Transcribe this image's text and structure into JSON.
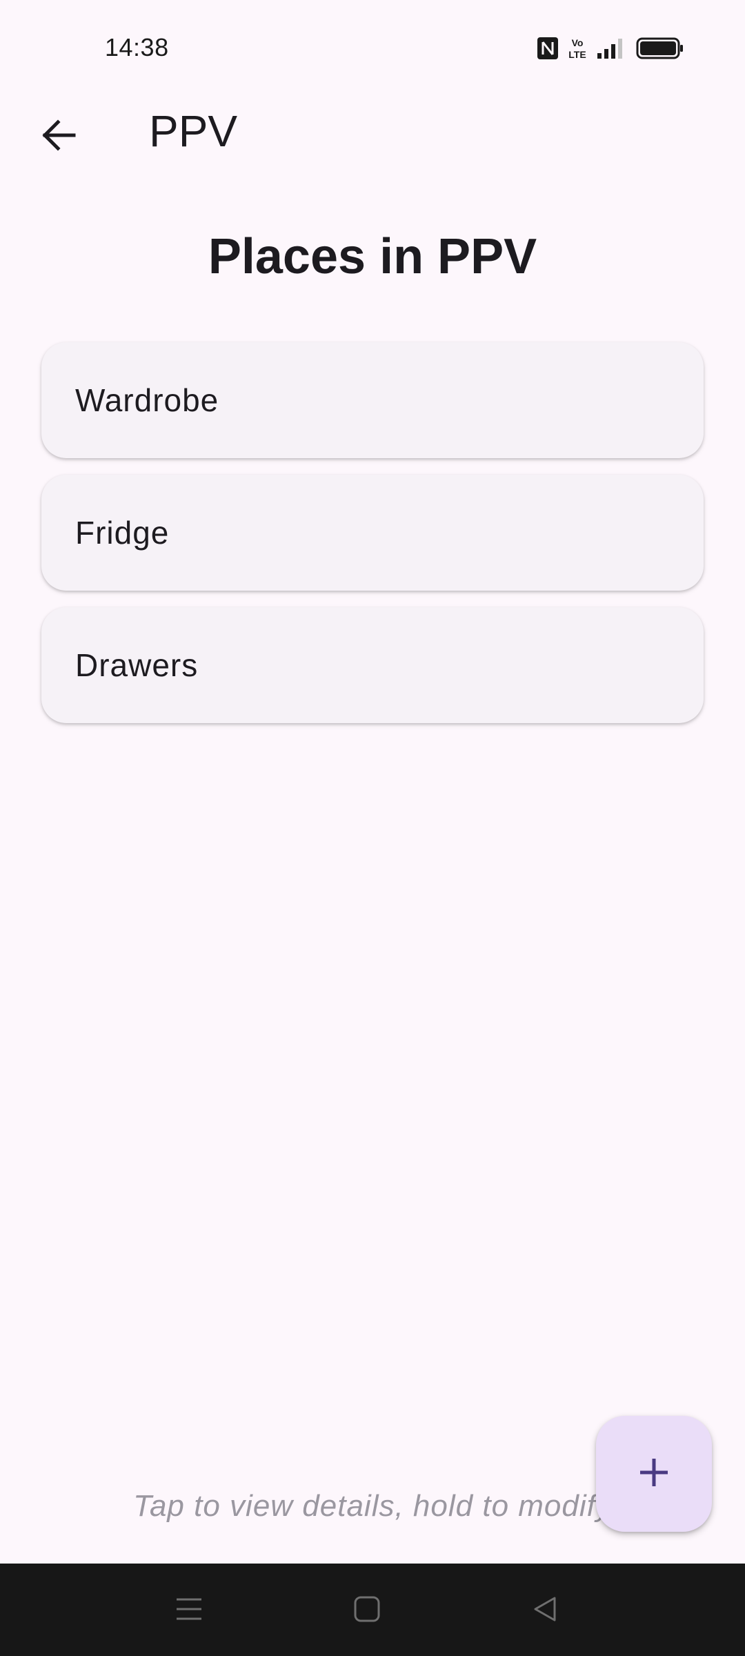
{
  "status_bar": {
    "time": "14:38",
    "icons": [
      "nfc-icon",
      "volte-icon",
      "signal-icon",
      "battery-icon"
    ]
  },
  "app_bar": {
    "title": "PPV",
    "back_icon": "arrow-back-icon"
  },
  "page": {
    "heading": "Places in PPV",
    "places": [
      {
        "label": "Wardrobe"
      },
      {
        "label": "Fridge"
      },
      {
        "label": "Drawers"
      }
    ],
    "hint": "Tap to view details, hold to modify"
  },
  "fab": {
    "icon": "plus-icon"
  },
  "nav_bar": {
    "icons": [
      "menu-icon",
      "home-square-icon",
      "back-triangle-icon"
    ]
  },
  "colors": {
    "background": "#fdf7fc",
    "card": "#f6f2f7",
    "fab": "#eaddf8",
    "fab_icon": "#4a3a82",
    "nav_bar": "#171717",
    "hint_text": "#9a97a0"
  }
}
